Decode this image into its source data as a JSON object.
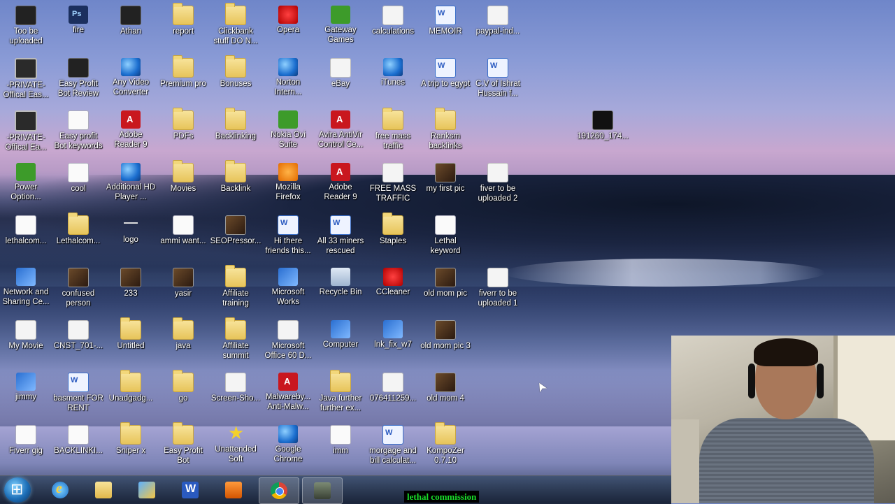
{
  "desktop": {
    "icons": [
      {
        "label": "Too be uploaded",
        "icon": "monitor-icon",
        "kind": "black"
      },
      {
        "label": "fire",
        "icon": "photoshop-icon",
        "kind": "ps"
      },
      {
        "label": "Athan",
        "icon": "app-icon",
        "kind": "black"
      },
      {
        "label": "report",
        "icon": "folder-icon",
        "kind": "folder"
      },
      {
        "label": "Clickbank stuff DO N...",
        "icon": "folder-icon",
        "kind": "folder"
      },
      {
        "label": "Opera",
        "icon": "opera-icon",
        "kind": "red"
      },
      {
        "label": "Gateway Games",
        "icon": "games-icon",
        "kind": "green"
      },
      {
        "label": "calculations",
        "icon": "document-icon",
        "kind": "blank"
      },
      {
        "label": "MEMOIR",
        "icon": "word-doc-icon",
        "kind": "word"
      },
      {
        "label": "paypal-ind...",
        "icon": "document-icon",
        "kind": "blank"
      },
      {
        "label": "-PRIVATE- Offical Eas...",
        "icon": "monitor-icon",
        "kind": "monitor"
      },
      {
        "label": "Easy Profit Bot Review",
        "icon": "monitor-icon",
        "kind": "black"
      },
      {
        "label": "Any Video Converter",
        "icon": "video-converter-icon",
        "kind": "globe"
      },
      {
        "label": "Premium pro",
        "icon": "folder-icon",
        "kind": "folder"
      },
      {
        "label": "Bonuses",
        "icon": "folder-icon",
        "kind": "folder"
      },
      {
        "label": "Norton Intern...",
        "icon": "norton-icon",
        "kind": "globe"
      },
      {
        "label": "eBay",
        "icon": "ebay-icon",
        "kind": "blank"
      },
      {
        "label": "iTunes",
        "icon": "itunes-icon",
        "kind": "globe"
      },
      {
        "label": "A trip to egypt",
        "icon": "word-doc-icon",
        "kind": "word"
      },
      {
        "label": "C.V of Ishrat Hussain  f...",
        "icon": "word-doc-icon",
        "kind": "word"
      },
      {
        "label": "-PRIVATE- Offical Ea...",
        "icon": "monitor-icon",
        "kind": "monitor"
      },
      {
        "label": "Easy profit Bot keywords",
        "icon": "document-icon",
        "kind": "doc"
      },
      {
        "label": "Adobe Reader 9",
        "icon": "pdf-icon",
        "kind": "pdf"
      },
      {
        "label": "PDFs",
        "icon": "folder-icon",
        "kind": "folder"
      },
      {
        "label": "Backlinking",
        "icon": "folder-icon",
        "kind": "folder"
      },
      {
        "label": "Nokia Ovi Suite",
        "icon": "ovi-icon",
        "kind": "green"
      },
      {
        "label": "Avira AntiVir Control Ce...",
        "icon": "avira-icon",
        "kind": "pdf"
      },
      {
        "label": "free mass traffic",
        "icon": "folder-icon",
        "kind": "folder"
      },
      {
        "label": "Ranksm backlinks",
        "icon": "folder-icon",
        "kind": "folder"
      },
      {
        "label": "Power Option...",
        "icon": "power-icon",
        "kind": "green"
      },
      {
        "label": "cool",
        "icon": "document-icon",
        "kind": "doc"
      },
      {
        "label": "Additional HD Player ...",
        "icon": "globe-icon",
        "kind": "globe"
      },
      {
        "label": "Movies",
        "icon": "folder-icon",
        "kind": "folder"
      },
      {
        "label": "Backlink",
        "icon": "folder-icon",
        "kind": "folder"
      },
      {
        "label": "Mozilla Firefox",
        "icon": "firefox-icon",
        "kind": "orange"
      },
      {
        "label": "Adobe Reader 9",
        "icon": "pdf-icon",
        "kind": "pdf"
      },
      {
        "label": "FREE MASS TRAFFIC",
        "icon": "image-icon",
        "kind": "blank"
      },
      {
        "label": "my first pic",
        "icon": "photo-icon",
        "kind": "photo"
      },
      {
        "label": "fiver to be uploaded 2",
        "icon": "image-icon",
        "kind": "blank"
      },
      {
        "label": "lethalcom...",
        "icon": "document-icon",
        "kind": "doc"
      },
      {
        "label": "Lethalcom...",
        "icon": "folder-icon",
        "kind": "folder"
      },
      {
        "label": "logo",
        "icon": "image-icon",
        "kind": "tiny"
      },
      {
        "label": "ammi want...",
        "icon": "document-icon",
        "kind": "doc"
      },
      {
        "label": "SEOPressor...",
        "icon": "winrar-icon",
        "kind": "photo"
      },
      {
        "label": "Hi there friends this...",
        "icon": "word-doc-icon",
        "kind": "word"
      },
      {
        "label": "All 33 miners rescued",
        "icon": "word-doc-icon",
        "kind": "word"
      },
      {
        "label": "Staples",
        "icon": "folder-icon",
        "kind": "folder"
      },
      {
        "label": "Lethal keyword",
        "icon": "document-icon",
        "kind": "doc"
      },
      {
        "label": "Network and Sharing Ce...",
        "icon": "network-icon",
        "kind": "net"
      },
      {
        "label": "confused person",
        "icon": "photo-icon",
        "kind": "photo"
      },
      {
        "label": "233",
        "icon": "photo-icon",
        "kind": "photo"
      },
      {
        "label": "yasir",
        "icon": "photo-icon",
        "kind": "photo"
      },
      {
        "label": "Affiliate training",
        "icon": "folder-icon",
        "kind": "folder"
      },
      {
        "label": "Microsoft Works",
        "icon": "works-icon",
        "kind": "net"
      },
      {
        "label": "Recycle Bin",
        "icon": "recycle-bin-icon",
        "kind": "bin"
      },
      {
        "label": "CCleaner",
        "icon": "ccleaner-icon",
        "kind": "red"
      },
      {
        "label": "old mom pic",
        "icon": "photo-icon",
        "kind": "photo"
      },
      {
        "label": "fiverr to be uploaded 1",
        "icon": "image-icon",
        "kind": "blank"
      },
      {
        "label": "My Movie",
        "icon": "movie-icon",
        "kind": "blank"
      },
      {
        "label": "CNST_701-...",
        "icon": "image-icon",
        "kind": "blank"
      },
      {
        "label": "Untitled",
        "icon": "folder-icon",
        "kind": "folder"
      },
      {
        "label": "java",
        "icon": "folder-icon",
        "kind": "folder"
      },
      {
        "label": "Affiliate summit",
        "icon": "folder-icon",
        "kind": "folder"
      },
      {
        "label": "Microsoft Office 60 D...",
        "icon": "office-icon",
        "kind": "blank"
      },
      {
        "label": "Computer",
        "icon": "computer-icon",
        "kind": "net"
      },
      {
        "label": "lnk_fix_w7",
        "icon": "registry-icon",
        "kind": "net"
      },
      {
        "label": "old mom pic 3",
        "icon": "photo-icon",
        "kind": "photo"
      },
      {
        "label": "jimmy",
        "icon": "photo-icon",
        "kind": "net"
      },
      {
        "label": "basment FOR RENT",
        "icon": "word-doc-icon",
        "kind": "word"
      },
      {
        "label": "Unadgadg...",
        "icon": "folder-icon",
        "kind": "folder"
      },
      {
        "label": "go",
        "icon": "folder-icon",
        "kind": "folder"
      },
      {
        "label": "Screen-Sho...",
        "icon": "photo-icon",
        "kind": "blank"
      },
      {
        "label": "Malwareby... Anti-Malw...",
        "icon": "malwarebytes-icon",
        "kind": "pdf"
      },
      {
        "label": "Java further further ex...",
        "icon": "folder-icon",
        "kind": "folder"
      },
      {
        "label": "076411259...",
        "icon": "image-icon",
        "kind": "blank"
      },
      {
        "label": "old mom 4",
        "icon": "photo-icon",
        "kind": "photo"
      },
      {
        "label": "Fiverr gig",
        "icon": "document-icon",
        "kind": "doc"
      },
      {
        "label": "BACKLINKI...",
        "icon": "document-icon",
        "kind": "doc"
      },
      {
        "label": "Sniper x",
        "icon": "folder-icon",
        "kind": "folder"
      },
      {
        "label": "Easy Profit Bot",
        "icon": "folder-icon",
        "kind": "folder"
      },
      {
        "label": "Unattended Soft",
        "icon": "star-icon",
        "kind": "star"
      },
      {
        "label": "Google Chrome",
        "icon": "chrome-icon",
        "kind": "globe"
      },
      {
        "label": "imm",
        "icon": "document-icon",
        "kind": "doc"
      },
      {
        "label": "morgage and bill calculat...",
        "icon": "word-doc-icon",
        "kind": "word"
      },
      {
        "label": "KompoZer 0.7.10",
        "icon": "folder-icon",
        "kind": "folder"
      },
      {
        "label": "191260_174...",
        "icon": "mobile-icon",
        "kind": "mobile"
      }
    ]
  },
  "taskbar": {
    "buttons": [
      {
        "name": "internet-explorer-icon",
        "kind": "ie"
      },
      {
        "name": "windows-explorer-icon",
        "kind": "folder"
      },
      {
        "name": "paint-icon",
        "kind": "paint"
      },
      {
        "name": "word-icon",
        "kind": "word"
      },
      {
        "name": "media-player-icon",
        "kind": "media"
      },
      {
        "name": "chrome-icon",
        "kind": "chrome"
      },
      {
        "name": "camera-recorder-icon",
        "kind": "cam"
      }
    ]
  },
  "overlay_text": "lethal commission"
}
